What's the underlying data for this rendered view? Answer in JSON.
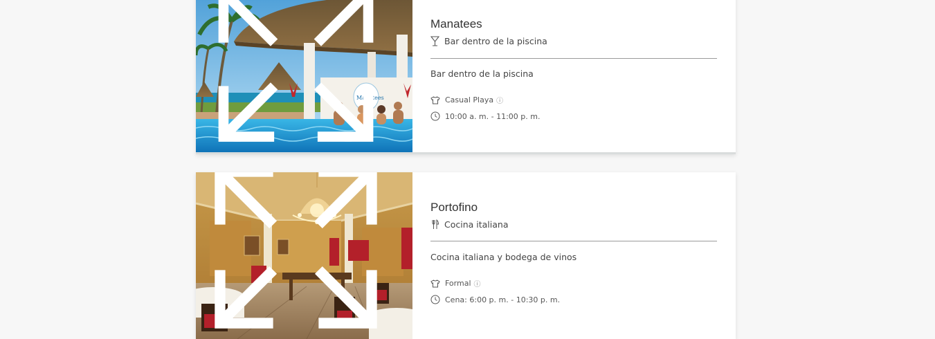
{
  "restaurants": [
    {
      "name": "Manatees",
      "type_icon": "cocktail-glass-icon",
      "type": "Bar dentro de la piscina",
      "description": "Bar dentro de la piscina",
      "dress_code_icon": "shirt-icon",
      "dress_code": "Casual Playa",
      "info_symbol": "ⓘ",
      "hours_icon": "clock-icon",
      "hours": "10:00 a. m. - 11:00 p. m.",
      "image_sign_text": "Manatees"
    },
    {
      "name": "Portofino",
      "type_icon": "fork-knife-icon",
      "type": "Cocina italiana",
      "description": "Cocina italiana y bodega de vinos",
      "dress_code_icon": "shirt-icon",
      "dress_code": "Formal",
      "info_symbol": "ⓘ",
      "hours_icon": "clock-icon",
      "hours": "Cena: 6:00 p. m. - 10:30 p. m."
    }
  ],
  "colors": {
    "page_background": "#f7f7f7",
    "card_background": "#ffffff",
    "divider": "#9a9a9a",
    "text": "#333333"
  }
}
